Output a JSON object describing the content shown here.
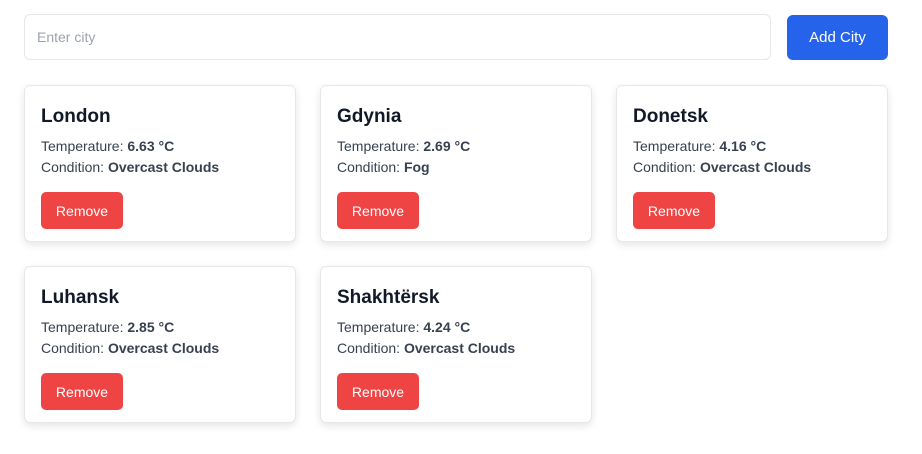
{
  "search": {
    "placeholder": "Enter city",
    "value": "",
    "add_label": "Add City"
  },
  "labels": {
    "temperature": "Temperature:",
    "condition": "Condition:",
    "remove": "Remove"
  },
  "colors": {
    "primary": "#2563eb",
    "danger": "#ef4444"
  },
  "cities": [
    {
      "name": "London",
      "temperature": "6.63 °C",
      "condition": "Overcast Clouds"
    },
    {
      "name": "Gdynia",
      "temperature": "2.69 °C",
      "condition": "Fog"
    },
    {
      "name": "Donetsk",
      "temperature": "4.16 °C",
      "condition": "Overcast Clouds"
    },
    {
      "name": "Luhansk",
      "temperature": "2.85 °C",
      "condition": "Overcast Clouds"
    },
    {
      "name": "Shakhtërsk",
      "temperature": "4.24 °C",
      "condition": "Overcast Clouds"
    }
  ]
}
